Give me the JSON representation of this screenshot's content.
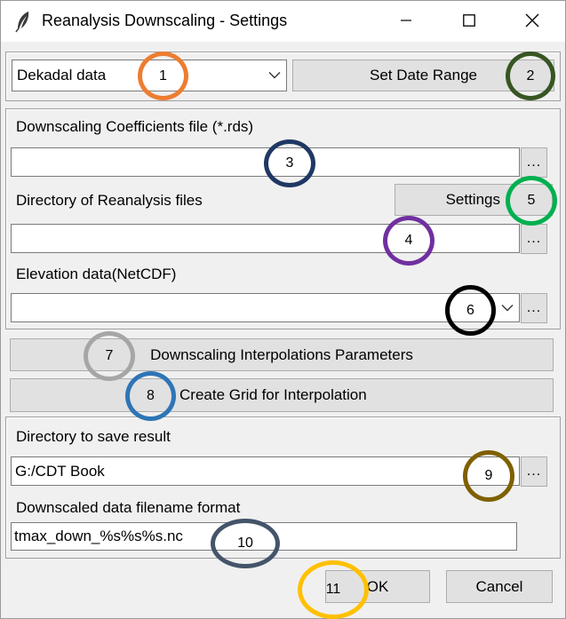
{
  "window": {
    "title": "Reanalysis Downscaling - Settings",
    "icon": "feather-icon",
    "controls": [
      "minimize-icon",
      "maximize-icon",
      "close-icon"
    ]
  },
  "top": {
    "data_type": "Dekadal data",
    "set_date_range_label": "Set Date Range"
  },
  "inputs": {
    "coef_label": "Downscaling Coefficients file (*.rds)",
    "coef_value": "",
    "reanalysis_dir_label": "Directory of Reanalysis files",
    "settings_label": "Settings",
    "reanalysis_dir_value": "",
    "elevation_label": "Elevation data(NetCDF)",
    "elevation_value": "",
    "browse_label": "..."
  },
  "actions": {
    "interp_params_label": "Downscaling Interpolations Parameters",
    "create_grid_label": "Create Grid for Interpolation"
  },
  "output": {
    "save_dir_label": "Directory to save result",
    "save_dir_value": "G:/CDT Book",
    "filename_format_label": "Downscaled data filename format",
    "filename_format_value": "tmax_down_%s%s%s.nc"
  },
  "footer": {
    "ok_label": "OK",
    "cancel_label": "Cancel"
  },
  "annotations": [
    {
      "label": "1",
      "color": "#ED7D31"
    },
    {
      "label": "2",
      "color": "#375623"
    },
    {
      "label": "3",
      "color": "#1F3864"
    },
    {
      "label": "4",
      "color": "#7030A0"
    },
    {
      "label": "5",
      "color": "#00B050"
    },
    {
      "label": "6",
      "color": "#000000"
    },
    {
      "label": "7",
      "color": "#A6A6A6"
    },
    {
      "label": "8",
      "color": "#2E75B6"
    },
    {
      "label": "9",
      "color": "#7F6000"
    },
    {
      "label": "10",
      "color": "#44546A"
    },
    {
      "label": "11",
      "color": "#FFC000"
    }
  ]
}
